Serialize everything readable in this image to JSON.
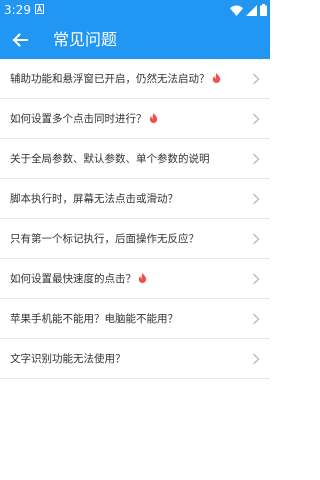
{
  "status_bar": {
    "time": "3:29",
    "app_icon": "a-notification-icon",
    "icons": [
      "wifi-icon",
      "signal-icon",
      "battery-icon"
    ]
  },
  "app_bar": {
    "title": "常见问题",
    "back_icon": "arrow-left-icon",
    "color": "#2196f3"
  },
  "faq_items": [
    {
      "label": "辅助功能和悬浮窗已开启，仍然无法启动？",
      "hot": true
    },
    {
      "label": "如何设置多个点击同时进行？",
      "hot": true
    },
    {
      "label": "关于全局参数、默认参数、单个参数的说明",
      "hot": false
    },
    {
      "label": "脚本执行时，屏幕无法点击或滑动？",
      "hot": false
    },
    {
      "label": "只有第一个标记执行，后面操作无反应？",
      "hot": false
    },
    {
      "label": "如何设置最快速度的点击？",
      "hot": true
    },
    {
      "label": "苹果手机能不能用？电脑能不能用？",
      "hot": false
    },
    {
      "label": "文字识别功能无法使用？",
      "hot": false
    }
  ],
  "colors": {
    "hot_icon": "#f0504a",
    "chevron": "#bdbdbd"
  }
}
